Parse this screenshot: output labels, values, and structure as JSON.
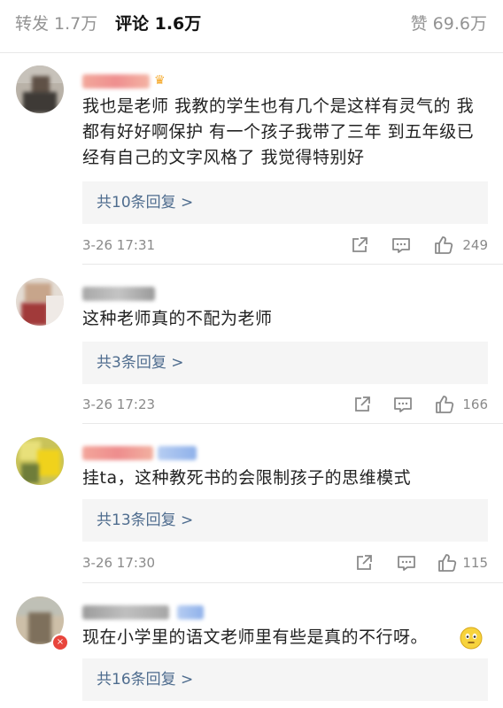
{
  "tabs": {
    "repost": "转发 1.7万",
    "comment": "评论 1.6万",
    "like": "赞 69.6万"
  },
  "comments": [
    {
      "text": "我也是老师 我教的学生也有几个是这样有灵气的 我都有好好啊保护 有一个孩子我带了三年 到五年级已经有自己的文字风格了 我觉得特别好",
      "replies": "共10条回复 >",
      "time": "3-26 17:31",
      "likes": "249"
    },
    {
      "text": "这种老师真的不配为老师",
      "replies": "共3条回复 >",
      "time": "3-26 17:23",
      "likes": "166"
    },
    {
      "text": "挂ta，这种教死书的会限制孩子的思维模式",
      "replies": "共13条回复 >",
      "time": "3-26 17:30",
      "likes": "115"
    },
    {
      "text": "现在小学里的语文老师里有些是真的不行呀。",
      "replies": "共16条回复 >",
      "time": "",
      "likes": ""
    }
  ],
  "colors": {
    "accent": "#ff8200",
    "link": "#4e6c8e",
    "meta": "#8a8a8a",
    "reply_bg": "#f5f5f5"
  },
  "icons": [
    "share-icon",
    "comment-icon",
    "like-icon",
    "emoji-icon"
  ]
}
